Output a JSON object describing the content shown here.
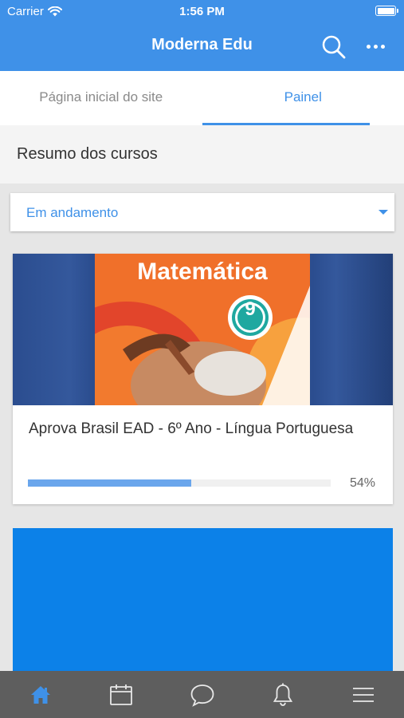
{
  "status_bar": {
    "carrier": "Carrier",
    "time": "1:56 PM"
  },
  "header": {
    "title": "Moderna Edu",
    "search_icon": "search-icon",
    "more_icon": "more-icon"
  },
  "tabs": [
    {
      "label": "Página inicial do site",
      "active": false
    },
    {
      "label": "Painel",
      "active": true
    }
  ],
  "section": {
    "title": "Resumo dos cursos"
  },
  "filter": {
    "selected": "Em andamento"
  },
  "courses": [
    {
      "cover_title": "Matemática",
      "cover_badge": "9",
      "title": "Aprova Brasil EAD - 6º Ano - Língua Portuguesa",
      "progress_percent": 54,
      "progress_label": "54%"
    },
    {
      "cover_color": "#0c81e8"
    }
  ],
  "tab_bar": {
    "items": [
      {
        "icon": "home-icon",
        "active": true
      },
      {
        "icon": "calendar-icon",
        "active": false
      },
      {
        "icon": "chat-icon",
        "active": false
      },
      {
        "icon": "bell-icon",
        "active": false
      },
      {
        "icon": "menu-icon",
        "active": false
      }
    ]
  },
  "colors": {
    "accent": "#3f91e8",
    "tab_bar": "#5e5e5e",
    "active_tab_icon": "#3f91e8"
  }
}
